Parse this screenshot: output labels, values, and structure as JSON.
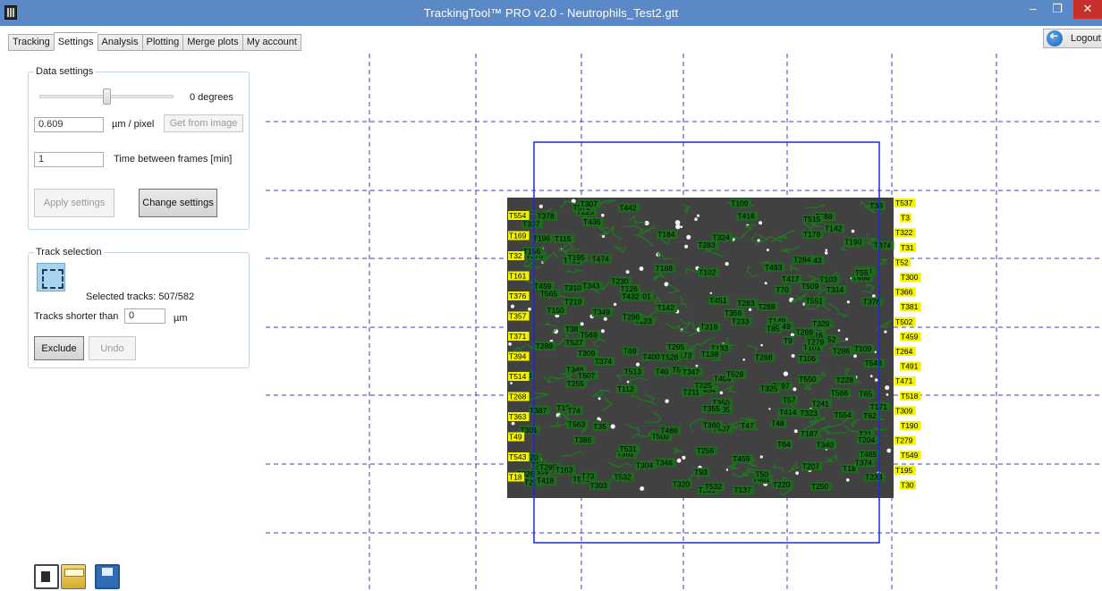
{
  "window": {
    "title": "TrackingTool™ PRO v2.0 - Neutrophils_Test2.gtt",
    "minimize_glyph": "–",
    "maximize_glyph": "❐",
    "close_glyph": "✕"
  },
  "tabs": [
    {
      "label": "Tracking",
      "active": false
    },
    {
      "label": "Settings",
      "active": true
    },
    {
      "label": "Analysis",
      "active": false
    },
    {
      "label": "Plotting",
      "active": false
    },
    {
      "label": "Merge plots",
      "active": false
    },
    {
      "label": "My account",
      "active": false
    }
  ],
  "logout": {
    "label": "Logout",
    "icon": "logout-icon"
  },
  "data_settings": {
    "title": "Data settings",
    "rotation_value": "0 degrees",
    "rotation_slider_fraction": 0.5,
    "um_per_pixel_value": "0.609",
    "um_per_pixel_label": "µm / pixel",
    "get_from_image_label": "Get from image",
    "time_value": "1",
    "time_label": "Time between frames [min]",
    "apply_label": "Apply settings",
    "change_label": "Change settings"
  },
  "track_selection": {
    "title": "Track selection",
    "selected_tracks": "Selected tracks: 507/582",
    "shorter_label": "Tracks shorter than",
    "shorter_value": "0",
    "unit": "µm",
    "exclude_label": "Exclude",
    "undo_label": "Undo"
  },
  "toolbar": {
    "icons": [
      "new-file-icon",
      "open-folder-icon",
      "save-icon"
    ]
  },
  "colors": {
    "titlebar": "#5b88c6",
    "close": "#c7302b",
    "grid": "#3c3cc8",
    "selection_box": "#1a2bd8",
    "track_label_yellow": "#f2f200",
    "track_label_green": "#1e6a1e"
  },
  "track_labels": {
    "left_edge": [
      "T554",
      "T169",
      "T32",
      "T161",
      "T376",
      "T357",
      "T371",
      "T394",
      "T514",
      "T268",
      "T363",
      "T49",
      "T543",
      "T18"
    ],
    "right_edge": [
      "T537",
      "T3",
      "T322",
      "T31",
      "T52",
      "T300",
      "T366",
      "T381",
      "T502",
      "T459",
      "T264",
      "T491",
      "T471",
      "T518",
      "T309",
      "T190",
      "T279",
      "T549",
      "T195",
      "T30"
    ]
  }
}
